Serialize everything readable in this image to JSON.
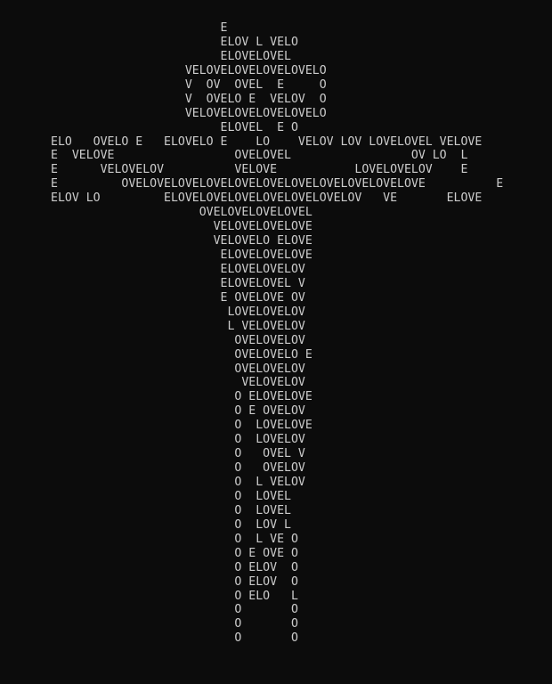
{
  "art": {
    "lines": [
      "                        E",
      "                        ELOV L VELO",
      "                        ELOVELOVEL",
      "                   VELOVELOVELOVELOVELO",
      "                   V  OV  OVEL  E     O",
      "                   V  OVELO E  VELOV  O",
      "                   VELOVELOVELOVELOVELO",
      "                        ELOVEL  E O",
      "ELO   OVELO E   ELOVELO E    LO    VELOV LOV LOVELOVEL VELOVE",
      "E  VELOVE                 OVELOVEL                 OV LO  L",
      "E      VELOVELOV          VELOVE           LOVELOVELOV    E",
      "E         OVELOVELOVELOVELOVELOVELOVELOVELOVELOVELOVE          E",
      "ELOV LO         ELOVELOVELOVELOVELOVELOVELOV   VE       ELOVE",
      "                     OVELOVELOVELOVEL",
      "                       VELOVELOVELOVE",
      "                       VELOVELO ELOVE",
      "                        ELOVELOVELOVE",
      "                        ELOVELOVELOV",
      "                        ELOVELOVEL V",
      "                        E OVELOVE OV",
      "                         LOVELOVELOV",
      "                         L VELOVELOV",
      "                          OVELOVELOV",
      "                          OVELOVELO E",
      "                          OVELOVELOV",
      "                           VELOVELOV",
      "                          O ELOVELOVE",
      "                          O E OVELOV",
      "                          O  LOVELOVE",
      "                          O  LOVELOV",
      "                          O   OVEL V",
      "                          O   OVELOV",
      "                          O  L VELOV",
      "                          O  LOVEL",
      "                          O  LOVEL",
      "                          O  LOV L",
      "                          O  L VE O",
      "                          O E OVE O",
      "                          O ELOV  O",
      "                          O ELOV  O",
      "                          O ELO   L",
      "                          O       O",
      "                          O       O",
      "                          O       O"
    ]
  }
}
